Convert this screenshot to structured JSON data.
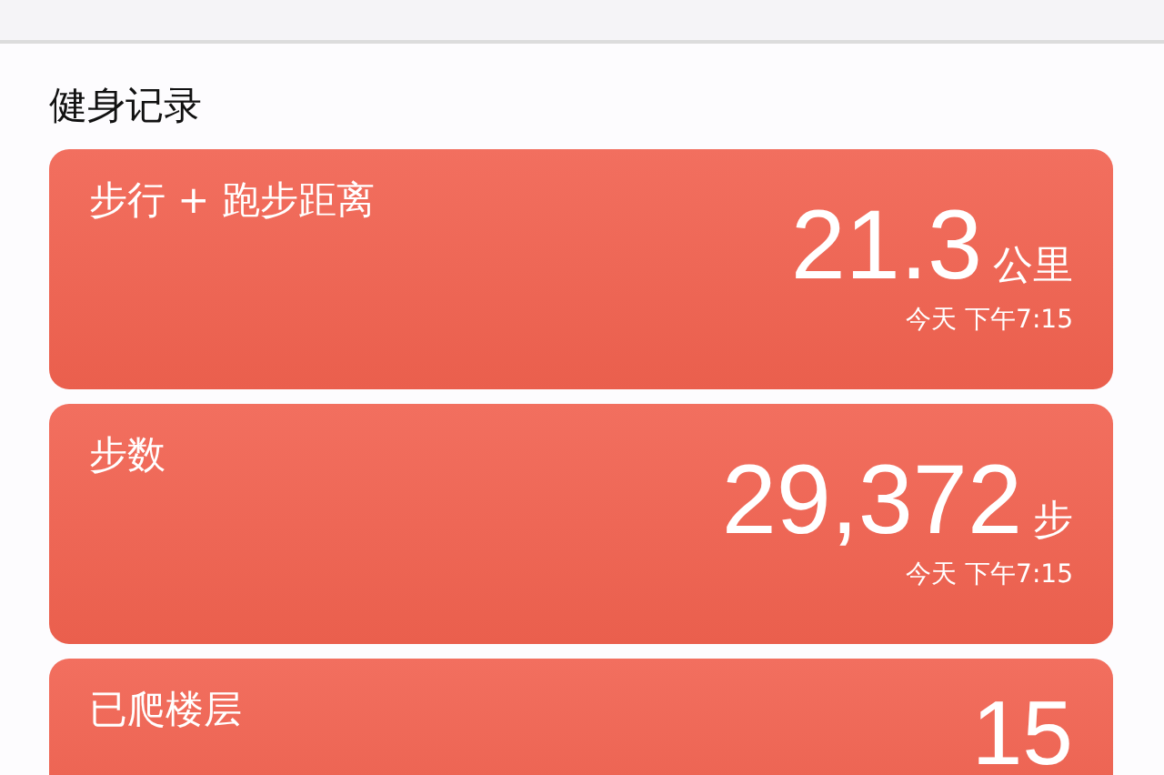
{
  "section_title": "健身记录",
  "cards": [
    {
      "title": "步行 + 跑步距离",
      "value": "21.3",
      "unit": "公里",
      "time": "今天 下午7:15"
    },
    {
      "title": "步数",
      "value": "29,372",
      "unit": "步",
      "time": "今天 下午7:15"
    },
    {
      "title": "已爬楼层",
      "value": "15"
    }
  ]
}
